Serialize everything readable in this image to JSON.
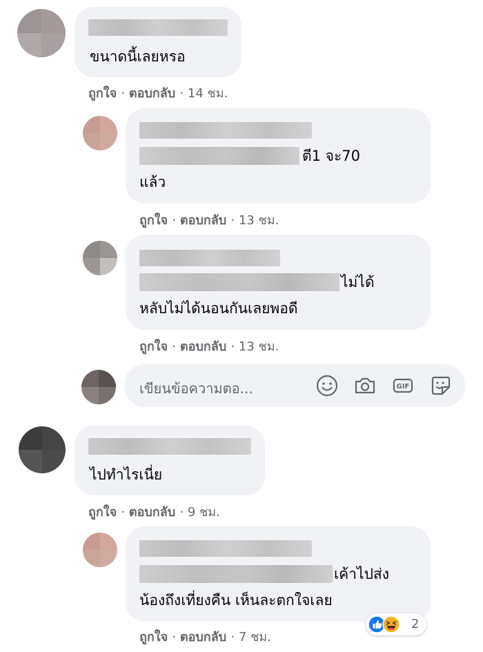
{
  "colors": {
    "bubble": "#f0f2f5",
    "action_text": "#65676b",
    "comment_text": "#050505",
    "like_blue": "#1877f2",
    "haha_yellow": "#f7b125"
  },
  "comments": [
    {
      "text": "ขนาดนี้เลยหรอ",
      "like": "ถูกใจ",
      "reply": "ตอบกลับ",
      "time": "14 ชม."
    },
    {
      "text_line1_end": "ตี1 จะ70",
      "text_line2": "แล้ว",
      "like": "ถูกใจ",
      "reply": "ตอบกลับ",
      "time": "13 ชม."
    },
    {
      "text_line1_end": "ไม่ได้",
      "text_line2": "หลับไม่ได้นอนกันเลยพอดี",
      "like": "ถูกใจ",
      "reply": "ตอบกลับ",
      "time": "13 ชม."
    },
    {
      "text": "ไปทำไรเนี่ย",
      "like": "ถูกใจ",
      "reply": "ตอบกลับ",
      "time": "9 ชม."
    },
    {
      "text_line1_end": "เค้าไปส่ง",
      "text_line2": "น้องถึงเที่ยงคืน เห็นละตกใจเลย",
      "like": "ถูกใจ",
      "reply": "ตอบกลับ",
      "time": "7 ชม.",
      "reactions": [
        "like-icon",
        "haha-icon"
      ],
      "reaction_count": "2"
    }
  ],
  "reply_box": {
    "placeholder": "เขียนข้อความตอ...",
    "icons": [
      "emoji-icon",
      "camera-icon",
      "gif-icon",
      "sticker-icon"
    ],
    "gif_label": "GIF"
  },
  "separator": "·"
}
